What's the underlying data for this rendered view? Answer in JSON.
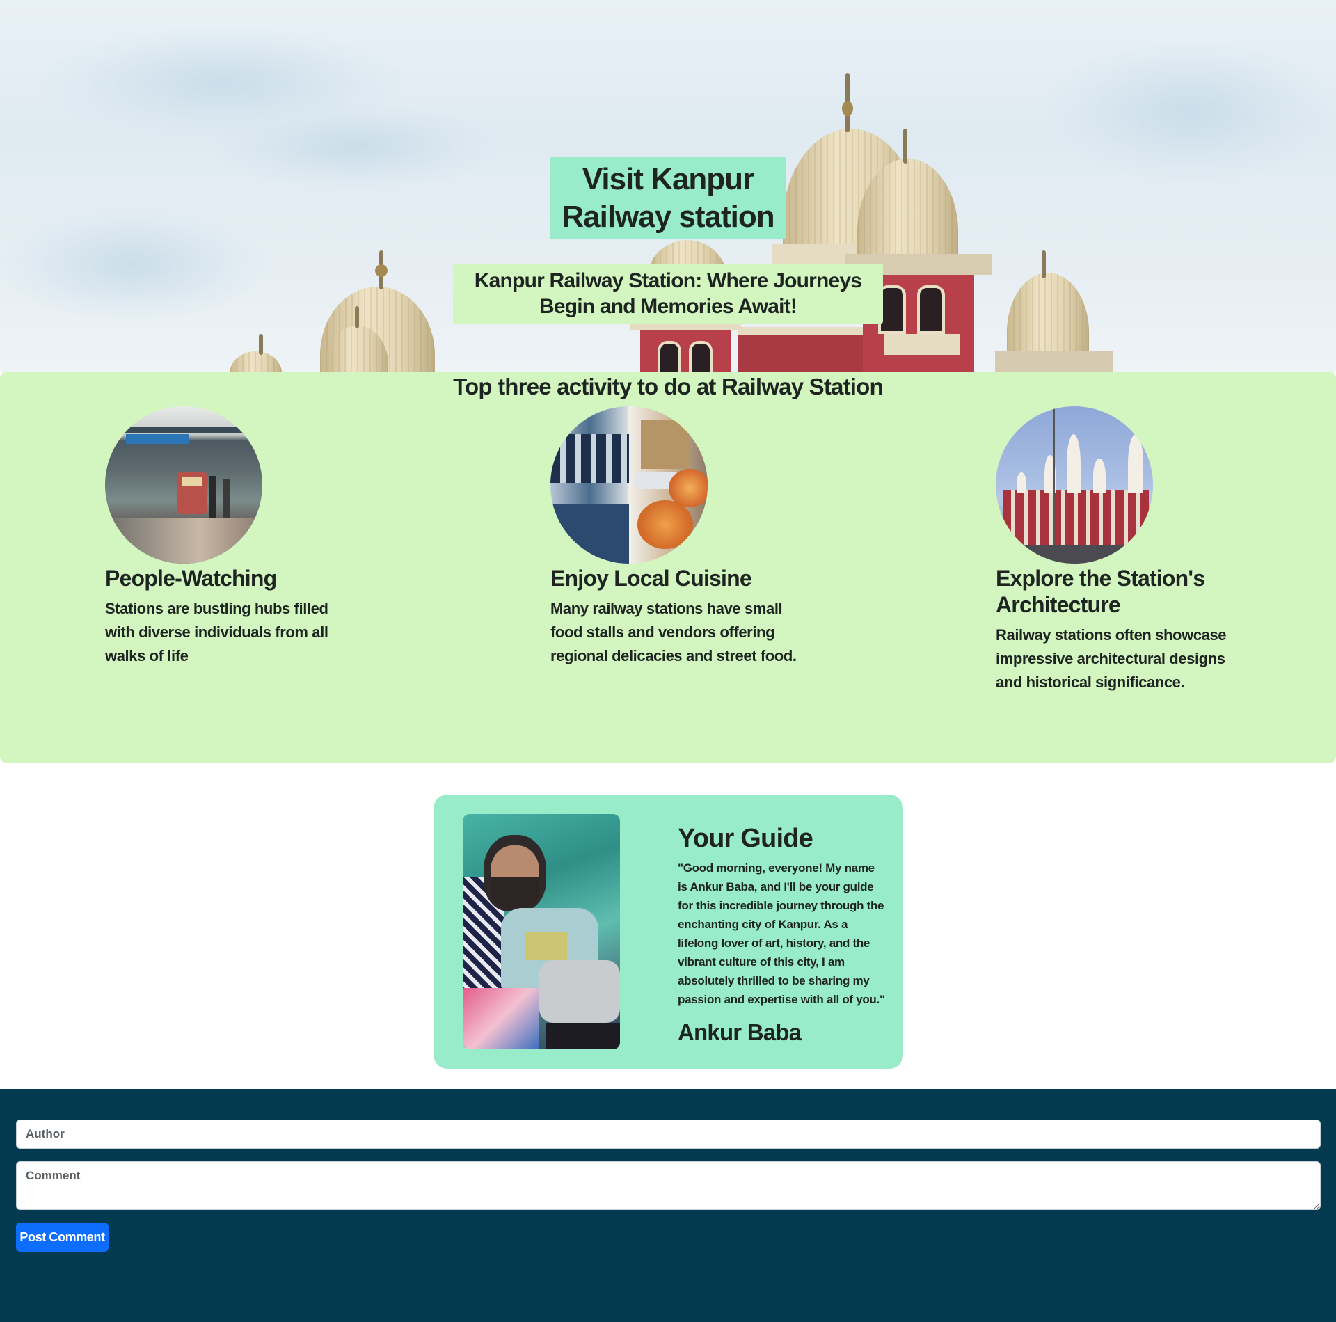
{
  "hero": {
    "title": "Visit Kanpur Railway station",
    "subtitle": "Kanpur Railway Station: Where Journeys Begin and Memories Await!"
  },
  "activities": {
    "heading": "Top three activity to do at Railway Station",
    "items": [
      {
        "title": "People-Watching",
        "text": "Stations are bustling hubs filled with diverse individuals from all walks of life",
        "image_icon": "train-platform-image"
      },
      {
        "title": "Enjoy Local Cuisine",
        "text": "Many railway stations have small food stalls and vendors offering regional delicacies and street food.",
        "image_icon": "street-food-image"
      },
      {
        "title": "Explore the Station's Architecture",
        "text": "Railway stations often showcase impressive architectural designs and historical significance.",
        "image_icon": "station-building-image"
      }
    ]
  },
  "guide": {
    "heading": "Your Guide",
    "quote": "\"Good morning, everyone! My name is Ankur Baba, and I'll be your guide for this incredible journey through the enchanting city of Kanpur. As a lifelong lover of art, history, and the vibrant culture of this city, I am absolutely thrilled to be sharing my passion and expertise with all of you.\"",
    "name": "Ankur Baba",
    "photo_icon": "guide-photo"
  },
  "comments": {
    "author_placeholder": "Author",
    "author_value": "",
    "comment_placeholder": "Comment",
    "comment_value": "",
    "submit_label": "Post Comment"
  },
  "colors": {
    "mint": "#99ecca",
    "light_green": "#d3f5bf",
    "footer_bg": "#043a4f",
    "button_blue": "#0d6efd",
    "text": "#1d2421"
  }
}
